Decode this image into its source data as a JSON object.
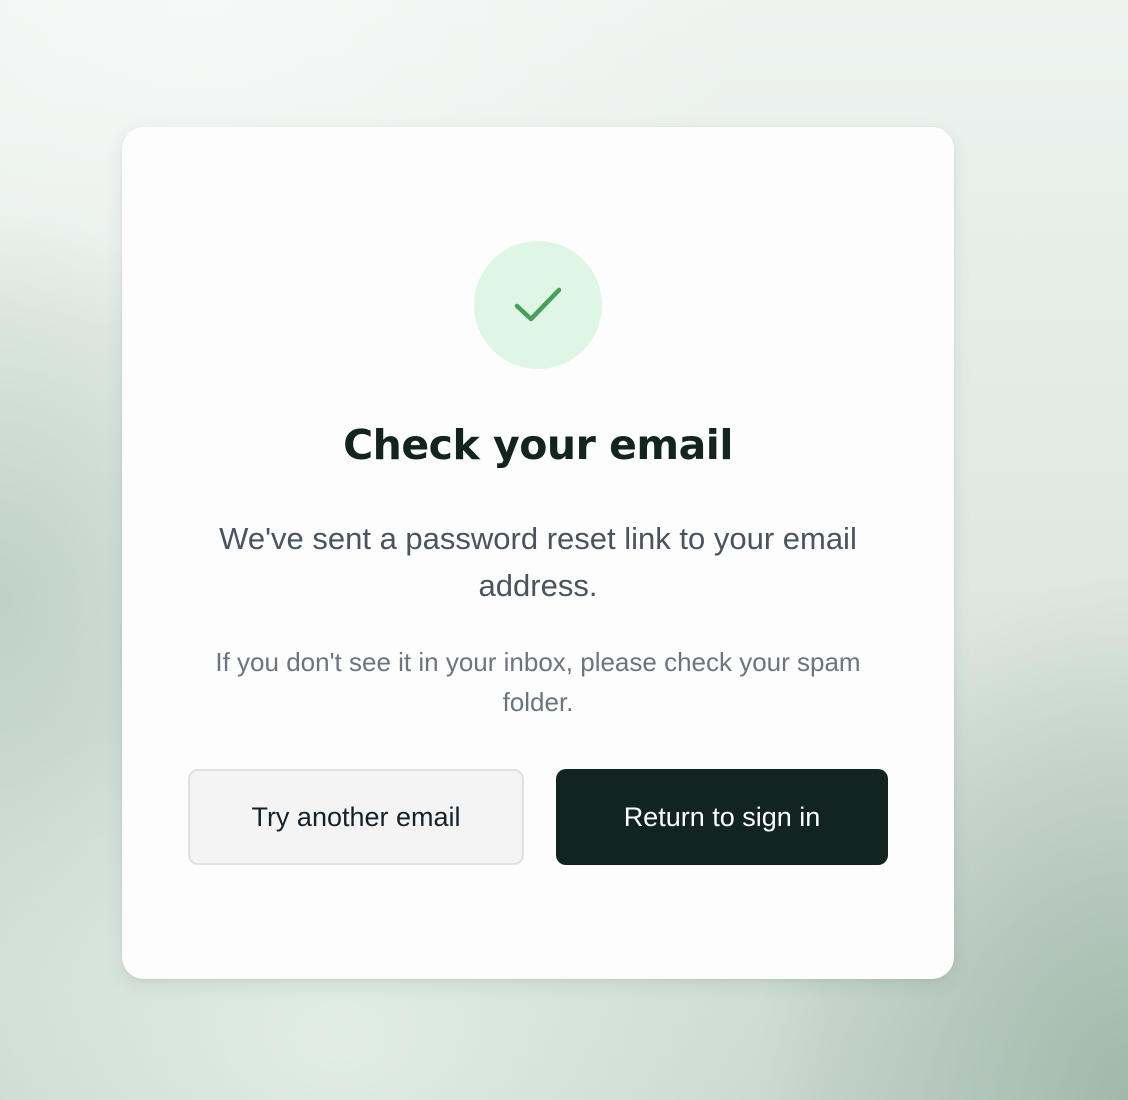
{
  "card": {
    "status_icon": "check-icon",
    "title": "Check your email",
    "message": "We've sent a password reset link to your email address.",
    "hint": "If you don't see it in your inbox, please check your spam folder."
  },
  "actions": {
    "try_another_label": "Try another email",
    "return_label": "Return to sign in"
  },
  "colors": {
    "primary_button": "#122420",
    "success_circle": "#e0f6e5",
    "success_check": "#4a9e5c",
    "title_text": "#13231e"
  }
}
